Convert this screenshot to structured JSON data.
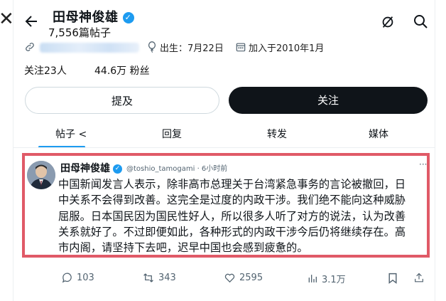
{
  "header": {
    "name": "田母神俊雄",
    "posts_count": "7,556篇帖子"
  },
  "profile": {
    "birth": "出生：7月22日",
    "joined": "加入于2010年1月",
    "following": "关注23人",
    "followers": "44.6万 粉丝"
  },
  "buttons": {
    "mention": "提及",
    "follow": "关注"
  },
  "tabs": [
    {
      "label": "帖子 <"
    },
    {
      "label": "回复"
    },
    {
      "label": "转发"
    },
    {
      "label": "媒体"
    }
  ],
  "post": {
    "author": "田母神俊雄",
    "handle_time": "@toshio_tamogami · 6小时前",
    "more": "···",
    "lines": [
      "中国新闻发言人表示，除非高市总理关于台湾紧急事务的言论被撤回，日",
      "中关系不会得到改善。这完全是过度的内政干涉。我们绝不能向这种威胁",
      "屈服。日本国民因为国民性好人，所以很多人听了对方的说法，认为改善",
      "关系就好了。不过即便如此，各种形式的内政干涉今后仍将继续存在。高",
      "市内阁，请坚持下去吧，迟早中国也会感到疲惫的。"
    ]
  },
  "actions": {
    "replies": "103",
    "reposts": "343",
    "likes": "2595",
    "views": "3.1万"
  },
  "colors": {
    "accent": "#1d9bf0",
    "highlight_border": "#e05a67"
  }
}
